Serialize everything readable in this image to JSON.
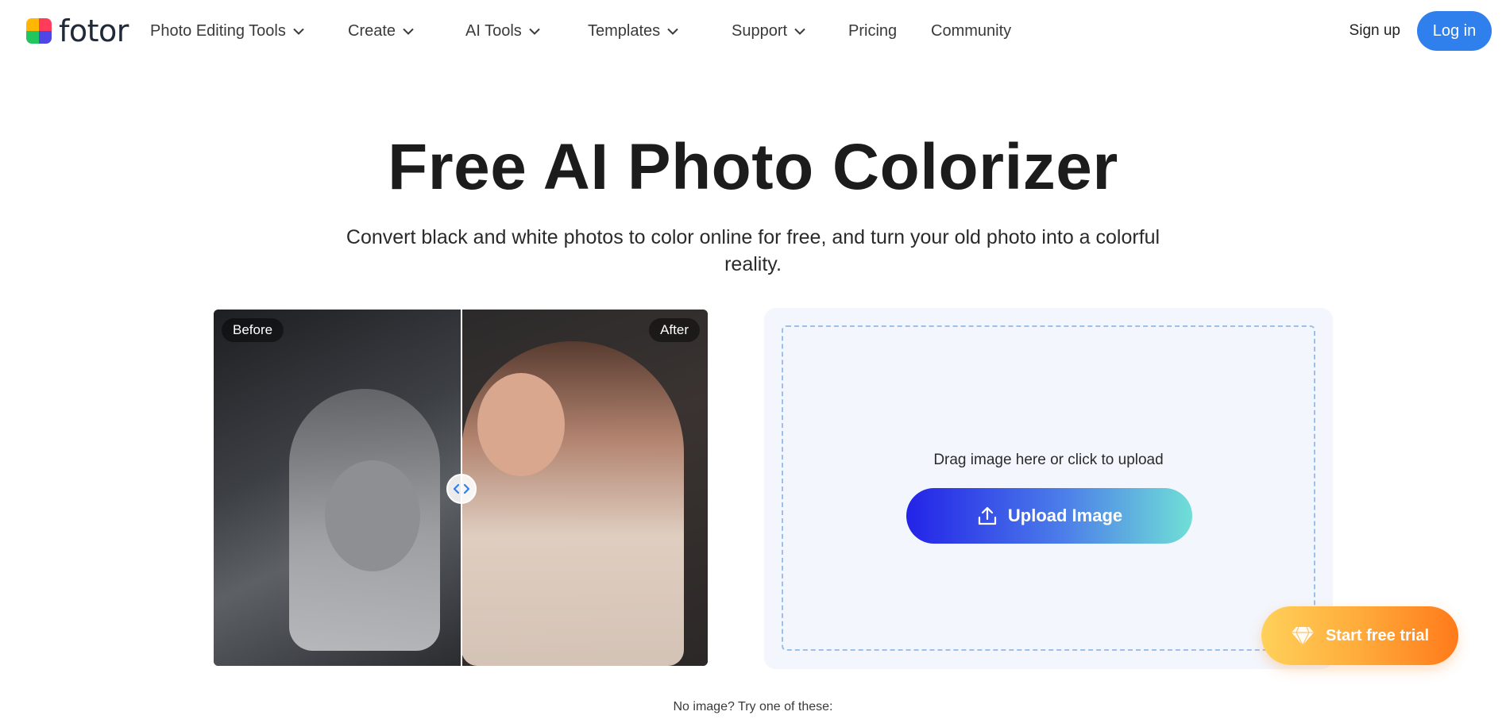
{
  "header": {
    "logo_text": "fotor",
    "nav": [
      {
        "label": "Photo Editing Tools",
        "dropdown": true
      },
      {
        "label": "Create",
        "dropdown": true
      },
      {
        "label": "AI Tools",
        "dropdown": true
      },
      {
        "label": "Templates",
        "dropdown": true
      },
      {
        "label": "Support",
        "dropdown": true
      },
      {
        "label": "Pricing",
        "dropdown": false
      },
      {
        "label": "Community",
        "dropdown": false
      }
    ],
    "signup_label": "Sign up",
    "login_label": "Log in"
  },
  "hero": {
    "title": "Free AI Photo Colorizer",
    "subtitle": "Convert black and white photos to color online for free, and turn your old photo into a colorful reality."
  },
  "compare": {
    "before_label": "Before",
    "after_label": "After"
  },
  "upload": {
    "drop_text": "Drag image here or click to upload",
    "button_label": "Upload Image"
  },
  "footer": {
    "try_text": "No image? Try one of these:",
    "trial_label": "Start free trial"
  },
  "colors": {
    "brand_blue": "#2f80ed",
    "upload_gradient_start": "#2323e8",
    "upload_gradient_end": "#70dfd6",
    "trial_gradient_start": "#ffd15a",
    "trial_gradient_end": "#ff7a1a",
    "panel_bg": "#f3f6fd"
  },
  "icons": {
    "logo": "fotor-logo-icon",
    "dropdown": "chevron-down-icon",
    "upload": "upload-icon",
    "trial": "diamond-icon",
    "slider": "left-right-arrows-icon"
  }
}
